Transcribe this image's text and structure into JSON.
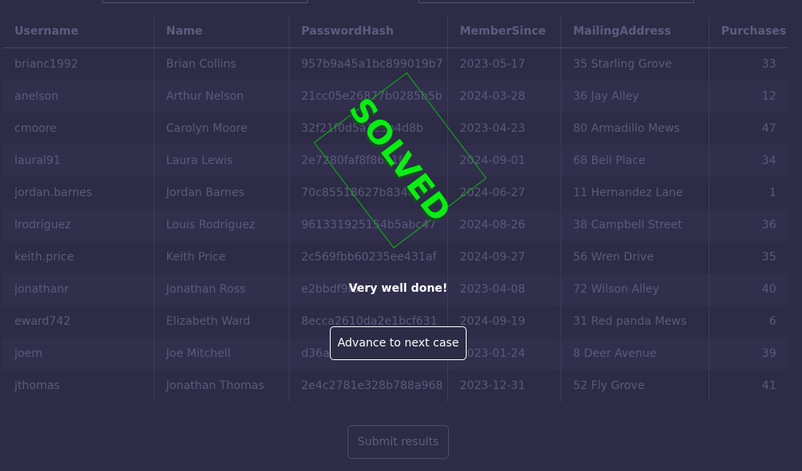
{
  "table": {
    "columns": [
      "Username",
      "Name",
      "PasswordHash",
      "MemberSince",
      "MailingAddress",
      "Purchases"
    ],
    "rows": [
      [
        "brianc1992",
        "Brian Collins",
        "957b9a45a1bc899019b7",
        "2023-05-17",
        "35 Starling Grove",
        "33"
      ],
      [
        "anelson",
        "Arthur Nelson",
        "21cc05e26877b0285b5b",
        "2024-03-28",
        "36 Jay Alley",
        "12"
      ],
      [
        "cmoore",
        "Carolyn Moore",
        "32f21f0d5a3e5b4d8b",
        "2023-04-23",
        "80 Armadillo Mews",
        "47"
      ],
      [
        "laural91",
        "Laura Lewis",
        "2e7280faf8f86a1fa",
        "2024-09-01",
        "68 Bell Place",
        "34"
      ],
      [
        "jordan.barnes",
        "Jordan Barnes",
        "70c85518627b8348",
        "2024-06-27",
        "11 Hernandez Lane",
        "1"
      ],
      [
        "lrodriguez",
        "Louis Rodriguez",
        "961331925154b5abc47",
        "2024-08-26",
        "38 Campbell Street",
        "36"
      ],
      [
        "keith.price",
        "Keith Price",
        "2c569fbb60235ee431af",
        "2024-09-27",
        "56 Wren Drive",
        "35"
      ],
      [
        "jonathanr",
        "Jonathan Ross",
        "e2bbdf9f5",
        "2023-04-08",
        "72 Wilson Alley",
        "40"
      ],
      [
        "eward742",
        "Elizabeth Ward",
        "8ecca2610da2e1bcf631",
        "2024-09-19",
        "31 Red panda Mews",
        "6"
      ],
      [
        "joem",
        "Joe Mitchell",
        "d36a",
        "2023-01-24",
        "8 Deer Avenue",
        "39"
      ],
      [
        "jthomas",
        "Jonathan Thomas",
        "2e4c2781e328b788a968",
        "2023-12-31",
        "52 Fly Grove",
        "41"
      ]
    ]
  },
  "submit_label": "Submit results",
  "overlay": {
    "stamp_text": "SOLVED",
    "message": "Very well done!",
    "advance_label": "Advance to next case"
  },
  "colors": {
    "background": "#2d2b46",
    "stamp": "#10ea1a"
  }
}
